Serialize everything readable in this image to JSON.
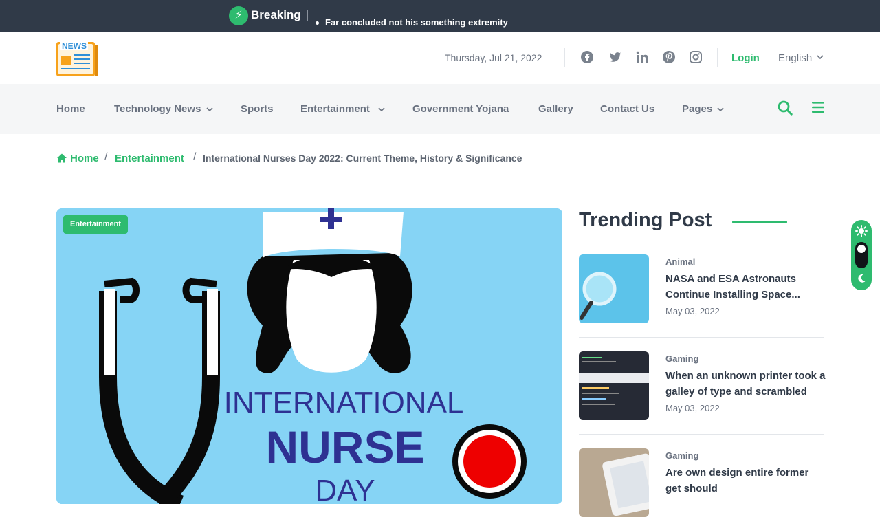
{
  "breaking": {
    "label": "Breaking",
    "headline": "Far concluded not his something extremity"
  },
  "header": {
    "logo_text": "NEWS",
    "date": "Thursday, Jul 21, 2022",
    "social": [
      "facebook-icon",
      "twitter-icon",
      "linkedin-icon",
      "pinterest-icon",
      "instagram-icon"
    ],
    "login_label": "Login",
    "language": "English"
  },
  "nav": {
    "items": [
      {
        "label": "Home",
        "has_dropdown": false
      },
      {
        "label": "Technology News",
        "has_dropdown": true
      },
      {
        "label": "Sports",
        "has_dropdown": false
      },
      {
        "label": "Entertainment",
        "has_dropdown": true
      },
      {
        "label": "Government Yojana",
        "has_dropdown": false
      },
      {
        "label": "Gallery",
        "has_dropdown": false
      },
      {
        "label": "Contact Us",
        "has_dropdown": false
      },
      {
        "label": "Pages",
        "has_dropdown": true
      }
    ]
  },
  "breadcrumb": {
    "home": "Home",
    "category": "Entertainment",
    "current": "International Nurses Day 2022: Current Theme, History & Significance"
  },
  "hero": {
    "badge": "Entertainment",
    "image_text_line1": "INTERNATIONAL",
    "image_text_line2": "NURSE",
    "image_text_line3": "DAY"
  },
  "trending": {
    "title": "Trending Post",
    "posts": [
      {
        "category": "Animal",
        "title": "NASA and ESA Astronauts Continue Installing Space...",
        "date": "May 03, 2022"
      },
      {
        "category": "Gaming",
        "title": "When an unknown printer took a galley of type and scrambled",
        "date": "May 03, 2022"
      },
      {
        "category": "Gaming",
        "title": "Are own design entire former get should",
        "date": ""
      }
    ]
  },
  "colors": {
    "accent": "#2ebb6f",
    "topbar": "#303a48",
    "nav_bg": "#f5f6f7",
    "hero_bg": "#86d4f5",
    "nurse_text": "#2e3192"
  }
}
